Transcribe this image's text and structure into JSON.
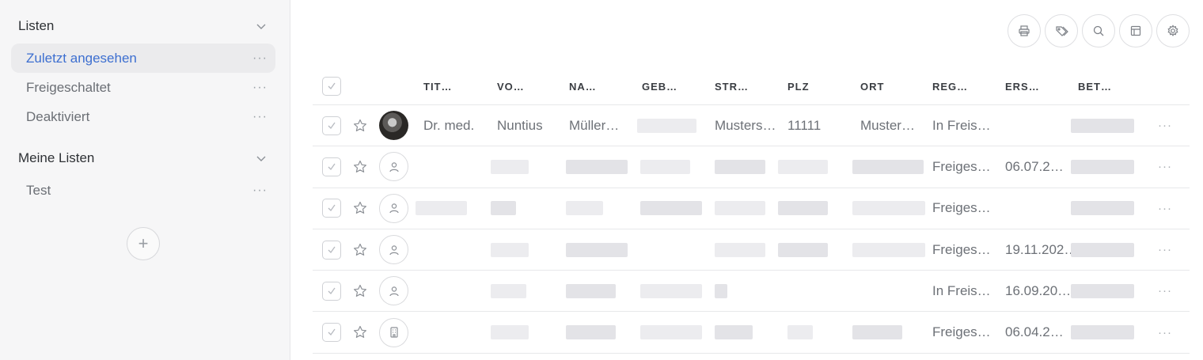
{
  "sidebar": {
    "sections": [
      {
        "title": "Listen",
        "items": [
          {
            "label": "Zuletzt angesehen",
            "active": true
          },
          {
            "label": "Freigeschaltet",
            "active": false
          },
          {
            "label": "Deaktiviert",
            "active": false
          }
        ]
      },
      {
        "title": "Meine Listen",
        "items": [
          {
            "label": "Test",
            "active": false
          }
        ]
      }
    ],
    "more_label": "···",
    "add_label": "+"
  },
  "toolbar": {
    "buttons": [
      "print-icon",
      "tags-icon",
      "search-icon",
      "columns-icon",
      "settings-icon"
    ]
  },
  "table": {
    "columns": [
      "TIT…",
      "VO…",
      "NA…",
      "GEB…",
      "STR…",
      "PLZ",
      "ORT",
      "REG…",
      "ERS…",
      "BET…"
    ],
    "rows": [
      {
        "avatar": "photo",
        "titel": "Dr. med.",
        "vorname": "Nuntius",
        "name": "Müller…",
        "strasse": "Musters…",
        "plz": "11111",
        "ort": "Muster…",
        "reg": "In Freis…",
        "ers": ""
      },
      {
        "avatar": "person-icon",
        "titel": "",
        "vorname": "",
        "name": "",
        "strasse": "",
        "plz": "",
        "ort": "",
        "reg": "Freiges…",
        "ers": "06.07.2…"
      },
      {
        "avatar": "person-icon",
        "titel": "",
        "vorname": "",
        "name": "",
        "strasse": "",
        "plz": "",
        "ort": "",
        "reg": "Freiges…",
        "ers": ""
      },
      {
        "avatar": "person-icon",
        "titel": "",
        "vorname": "",
        "name": "",
        "strasse": "",
        "plz": "",
        "ort": "",
        "reg": "Freiges…",
        "ers": "19.11.202…"
      },
      {
        "avatar": "person-icon",
        "titel": "",
        "vorname": "",
        "name": "",
        "strasse": "",
        "plz": "",
        "ort": "",
        "reg": "In Freis…",
        "ers": "16.09.20…"
      },
      {
        "avatar": "building-icon",
        "titel": "",
        "vorname": "",
        "name": "",
        "strasse": "",
        "plz": "",
        "ort": "",
        "reg": "Freiges…",
        "ers": "06.04.2…"
      }
    ],
    "row_more_label": "···"
  }
}
